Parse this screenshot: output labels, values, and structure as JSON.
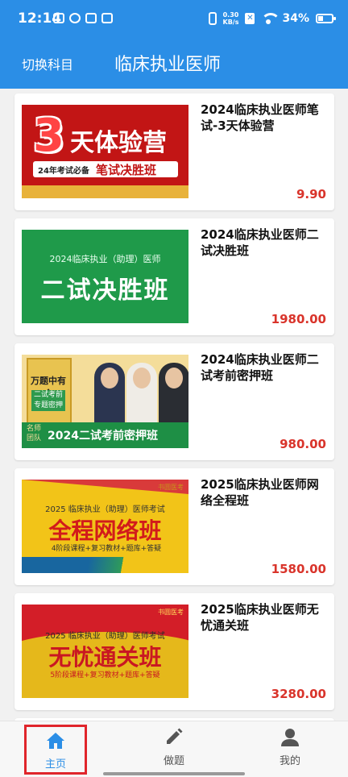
{
  "status_bar": {
    "time": "12:14",
    "net_speed_value": "0.30",
    "net_speed_unit": "KB/s",
    "battery": "34%"
  },
  "header": {
    "switch_subject": "切换科目",
    "title": "临床执业医师"
  },
  "courses": [
    {
      "title": "2024临床执业医师笔试-3天体验营",
      "price": "9.90",
      "thumb": {
        "big": "3",
        "main": "天体验营",
        "bar_left": "24年考试必备",
        "bar_right": "笔试决胜班"
      }
    },
    {
      "title": "2024临床执业医师二试决胜班",
      "price": "1980.00",
      "thumb": {
        "sub": "2024临床执业（助理）医师",
        "main": "二试决胜班"
      }
    },
    {
      "title": "2024临床执业医师二试考前密押班",
      "price": "980.00",
      "thumb": {
        "book_title": "万题中有金",
        "book_tag": "二试考前专题密押",
        "tag": "名师团队",
        "main": "2024二试考前密押班"
      }
    },
    {
      "title": "2025临床执业医师网络全程班",
      "price": "1580.00",
      "thumb": {
        "logo": "书圆医考",
        "sub": "2025 临床执业（助理）医师考试",
        "main": "全程网络班",
        "foot": "4阶段课程+复习教材+题库+答疑"
      }
    },
    {
      "title": "2025临床执业医师无忧通关班",
      "price": "3280.00",
      "thumb": {
        "logo": "书圆医考",
        "sub": "2025 临床执业（助理）医师考试",
        "main": "无忧通关班",
        "foot": "5阶段课程+复习教材+题库+答疑"
      }
    }
  ],
  "bottom_nav": {
    "home": "主页",
    "practice": "做题",
    "mine": "我的"
  },
  "colors": {
    "primary": "#2b8ee6",
    "price": "#d9342b",
    "highlight_border": "#e0252b"
  }
}
